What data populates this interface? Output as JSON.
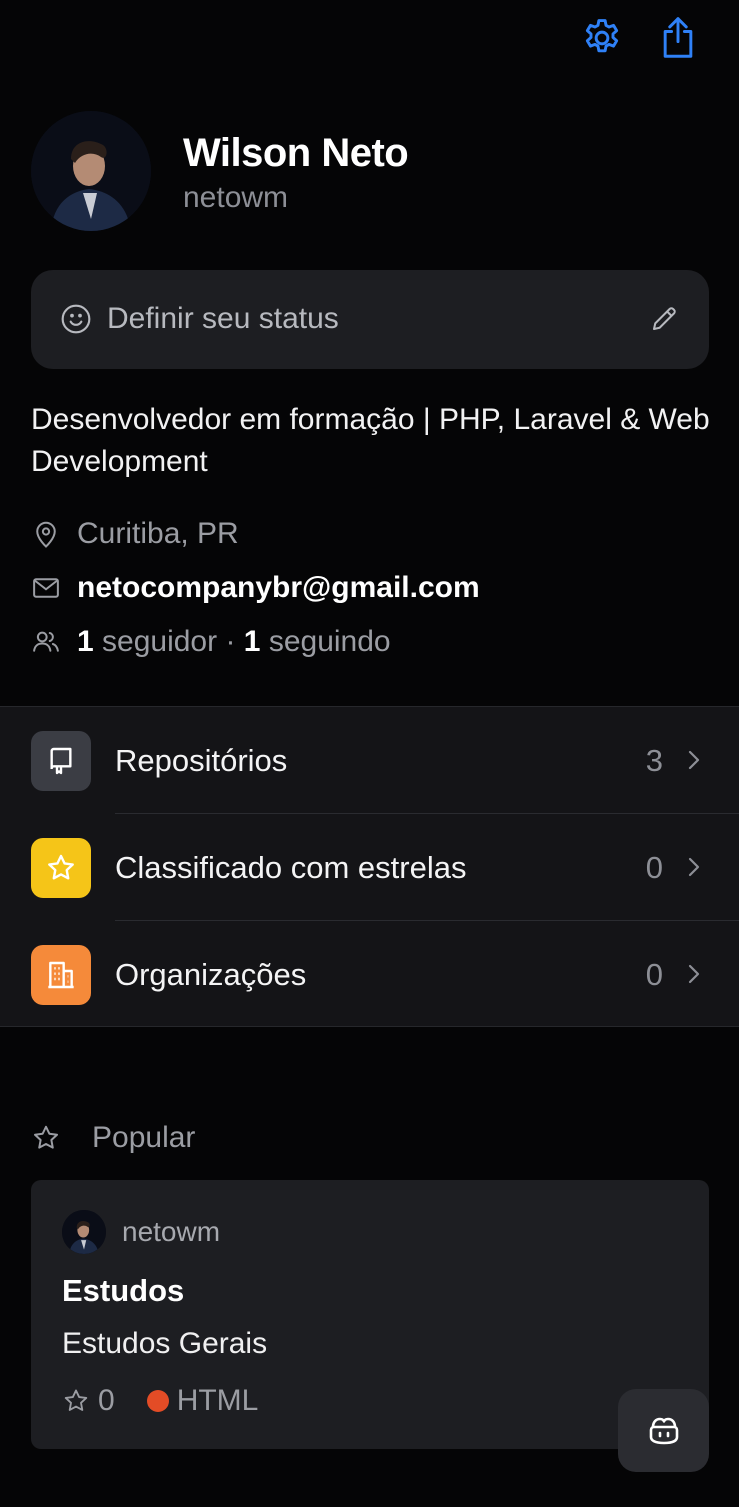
{
  "header": {
    "settings_icon": "gear-icon",
    "share_icon": "share-icon",
    "accent": "#2f81f7"
  },
  "profile": {
    "name": "Wilson Neto",
    "username": "netowm",
    "status_placeholder": "Definir seu status",
    "bio": "Desenvolvedor em formação | PHP, Laravel & Web Development",
    "location": "Curitiba, PR",
    "email": "netocompanybr@gmail.com",
    "followers_count": "1",
    "followers_label": "seguidor",
    "separator": "·",
    "following_count": "1",
    "following_label": "seguindo"
  },
  "menu": {
    "items": [
      {
        "label": "Repositórios",
        "count": "3",
        "icon": "repo-icon",
        "color": "#3b3d44"
      },
      {
        "label": "Classificado com estrelas",
        "count": "0",
        "icon": "star-icon",
        "color": "#f5c518"
      },
      {
        "label": "Organizações",
        "count": "0",
        "icon": "organization-icon",
        "color": "#f58a3a"
      }
    ]
  },
  "popular": {
    "label": "Popular",
    "card": {
      "owner": "netowm",
      "repo": "Estudos",
      "description": "Estudos Gerais",
      "stars": "0",
      "language": "HTML",
      "language_color": "#e34c26"
    }
  }
}
